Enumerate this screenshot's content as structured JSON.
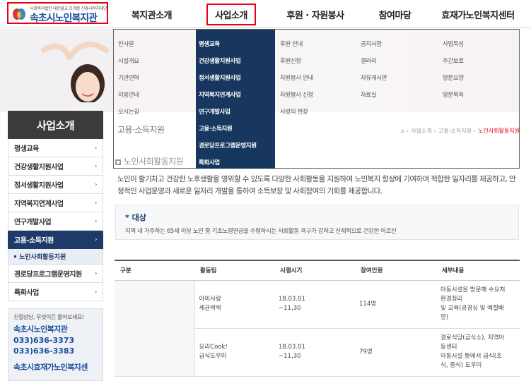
{
  "logo": {
    "subtitle": "사회복지법인 대한불교 조계종 신흥사복지재단",
    "name": "속초시노인복지관"
  },
  "gnb": {
    "items": [
      {
        "label": "복지관소개"
      },
      {
        "label": "사업소개"
      },
      {
        "label": "후원 · 자원봉사"
      },
      {
        "label": "참여마당"
      },
      {
        "label": "효재가노인복지센터"
      }
    ]
  },
  "mega_menu": {
    "col1": [
      "인사말",
      "시설개요",
      "기관연혁",
      "이용안내",
      "오시는길"
    ],
    "col2": [
      "평생교육",
      "건강생활지원사업",
      "정서생활지원사업",
      "지역복지연계사업",
      "연구개발사업",
      "고용·소득지원",
      "경로당프로그램운영지원",
      "특화사업"
    ],
    "col3": [
      "후원 안내",
      "후원신청",
      "자원봉사 안내",
      "자원봉사 신청",
      "사랑의 현장"
    ],
    "col4": [
      "공지사항",
      "갤러리",
      "자유게시판",
      "자료실"
    ],
    "col5": [
      "사업특성",
      "주간보호",
      "방문요양",
      "방문목욕"
    ]
  },
  "sidebar": {
    "title": "사업소개",
    "items": [
      {
        "label": "평생교육"
      },
      {
        "label": "건강생활지원사업"
      },
      {
        "label": "정서생활지원사업"
      },
      {
        "label": "지역복지연계사업"
      },
      {
        "label": "연구개발사업"
      },
      {
        "label": "고용-소득지원"
      },
      {
        "label": "경로당프로그램운영지원"
      },
      {
        "label": "특화사업"
      }
    ],
    "sub_item": "노인사회활동지원",
    "chevron": "›"
  },
  "contact": {
    "line1": "친절상담, 무엇이든 물어보세요!",
    "name": "속초시노인복지관",
    "tel1": "033)636-3373",
    "tel2": "033)636-3383",
    "name2": "속초시효재가노인복지센"
  },
  "content": {
    "category": "고용·소득지원",
    "breadcrumb": [
      "사업소개",
      "고용-소득지원",
      "노인사회활동지원"
    ],
    "page_title": "노인사회활동지원",
    "intro": "노인이 활기차고 건강한 노후생활을 영위할 수 있도록 다양한 사회활동을 지원하여 노인복지 향상에 기여하며 적합한 일자리를 제공하고, 안정적인 사업운영과 새로운 일자리 개발을 통하여 소득보장 및 사회참여의 기회를 제공합니다.",
    "target_title": "* 대상",
    "target_desc": "지역 내 거주하는 65세 이상 노인 중 기초노령연금을 수령하시는 사회활동 욕구가 강하고 신체적으로 건강한 어르신"
  },
  "table": {
    "headers": [
      "구분",
      "활동팀",
      "시행시기",
      "참여인원",
      "세부내용"
    ],
    "rows": [
      {
        "team": "아이사랑\n세균싹싹",
        "period": "18.03.01\n~11,30",
        "people": "114명",
        "detail": "아동시설을 방문해 수요처\n환경정리\n및 교육(공경심 및 예절배\n양)"
      },
      {
        "team": "요리Cook!\n급식도우미",
        "period": "18.03.01\n~11,30",
        "people": "79명",
        "detail": "경로식당(급식소), 지역아\n동센터\n아동시설 등에서 급식(조\n식, 중식) 도우미"
      }
    ]
  },
  "colors": {
    "navy": "#17375f",
    "brand_blue": "#1b4f9c",
    "highlight_red": "#e60012"
  }
}
